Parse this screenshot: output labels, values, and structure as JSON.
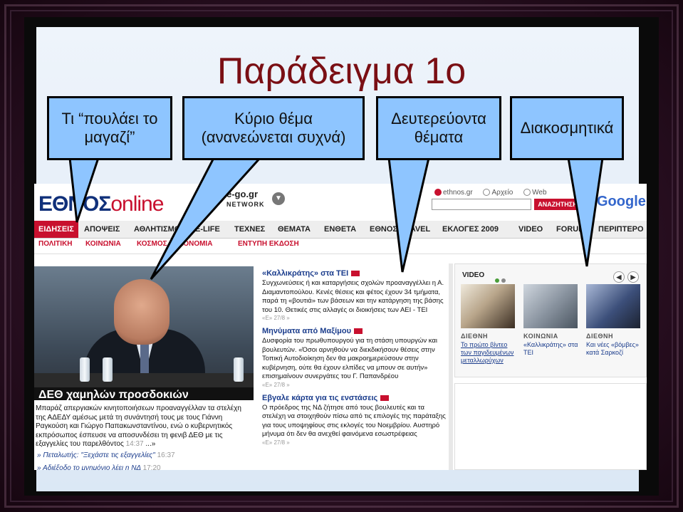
{
  "slide": {
    "title": "Παράδειγμα 1ο",
    "callouts": [
      {
        "text": "Τι “πουλάει το μαγαζί”"
      },
      {
        "text": "Κύριο θέμα (ανανεώνεται συχνά)"
      },
      {
        "text": "Δευτερεύοντα θέματα"
      },
      {
        "text": "Διακοσμητικά"
      }
    ]
  },
  "site": {
    "logo_part1": "ΕΘΝΟΣ",
    "logo_part2": "online",
    "network_brand": "e-go.gr",
    "network_label": "NETWORK",
    "search_options": [
      "ethnos.gr",
      "Αρχείο",
      "Web"
    ],
    "search_button": "ΑΝΑΖΗΤΗΣΗ",
    "google": "Google",
    "nav": [
      "ΕΙΔΗΣΕΙΣ",
      "ΑΠΟΨΕΙΣ",
      "ΑΘΛΗΤΙΣΜΟΣ",
      "E-LIFE",
      "ΤΕΧΝΕΣ",
      "ΘΕΜΑΤΑ",
      "ΕΝΘΕΤΑ",
      "ΕΘΝΟΣ TRAVEL",
      "ΕΚΛΟΓΕΣ 2009",
      "VIDEO",
      "FORUM",
      "ΠΕΡΙΠΤΕΡΟ"
    ],
    "subnav": [
      "ΠΟΛΙΤΙΚΗ",
      "ΚΟΙΝΩΝΙΑ",
      "ΚΟΣΜΟΣ",
      "ΟΙΚΟΝΟΜΙΑ",
      "ΕΝΤΥΠΗ ΕΚΔΟΣΗ"
    ]
  },
  "main_story": {
    "caption": "ΔΕΘ χαμηλών προσδοκιών",
    "body": "Μπαράζ απεργιακών κινητοποιήσεων προαναγγέλλαν τα στελέχη της ΑΔΕΔΥ αμέσως μετά τη συνάντησή τους με τους Γιάννη Ραγκούση και Γιώργο Παπακωνσταντίνου, ενώ ο κυβερνητικός εκπρόσωπος έσπευσε να αποσυνδέσει τη φενιβ ΔΕΘ με τις εξαγγελίες του παρελθόντος",
    "body_time": "14:37",
    "more": "...»",
    "links": [
      {
        "text": "» Πεταλωτής: \"Ξεχάστε τις εξαγγελίες\"",
        "time": "16:37"
      },
      {
        "text": "» Αδιέξοδο το μνημόνιο λέει η ΝΔ",
        "time": "17:20"
      }
    ]
  },
  "secondary_stories": [
    {
      "title": "«Καλλικράτης» στα ΤΕΙ",
      "body": "Συγχωνεύσεις ή και καταργήσεις σχολών προαναγγέλλει η Α. Διαμαντοπούλου. Κενές θέσεις και φέτος έχουν 34 τμήματα, παρά τη «βουτιά» των βάσεων και την κατάργηση της βάσης του 10. Θετικές στις αλλαγές οι διοικήσεις των ΑΕΙ - ΤΕΙ",
      "meta": "«Ε» 27/8 »"
    },
    {
      "title": "Μηνύματα από Μαξίμου",
      "body": "Δυσφορία του πρωθυπουργού για τη στάση υπουργών και βουλευτών. «Όσοι αρνηθούν να διεκδικήσουν θέσεις στην Τοπική Αυτοδιοίκηση δεν θα μακροημερεύσουν στην κυβέρνηση, ούτε θα έχουν ελπίδες να μπουν σε αυτήν» επισημαίνουν συνεργάτες του Γ. Παπανδρέου",
      "meta": "«Ε» 27/8 »"
    },
    {
      "title": "Εβγαλε κάρτα για τις ενστάσεις",
      "body": "Ο πρόεδρος της ΝΔ ζήτησε από τους βουλευτές και τα στελέχη να στοιχηθούν πίσω από τις επιλογές της παράταξης για τους υποψηφίους στις εκλογές του Νοεμβρίου. Αυστηρό μήνυμα ότι δεν θα ανεχθεί φαινόμενα εσωστρέφειας",
      "meta": "«Ε» 27/8 »"
    }
  ],
  "video": {
    "header": "VIDEO",
    "items": [
      {
        "category": "ΔΙΕΘΝΗ",
        "caption": "Το πρώτο βίντεο των παγιδευμένων μεταλλωρύχων"
      },
      {
        "category": "ΚΟΙΝΩΝΙΑ",
        "caption": "«Καλλικράτης» στα ΤΕΙ"
      },
      {
        "category": "ΔΙΕΘΝΗ",
        "caption": "Και νέες «βόμβες» κατά Σαρκοζί"
      }
    ]
  },
  "colors": {
    "brand_red": "#c8102e",
    "brand_blue": "#10307a",
    "callout_fill": "#8ec5ff",
    "title": "#7a0f14"
  }
}
